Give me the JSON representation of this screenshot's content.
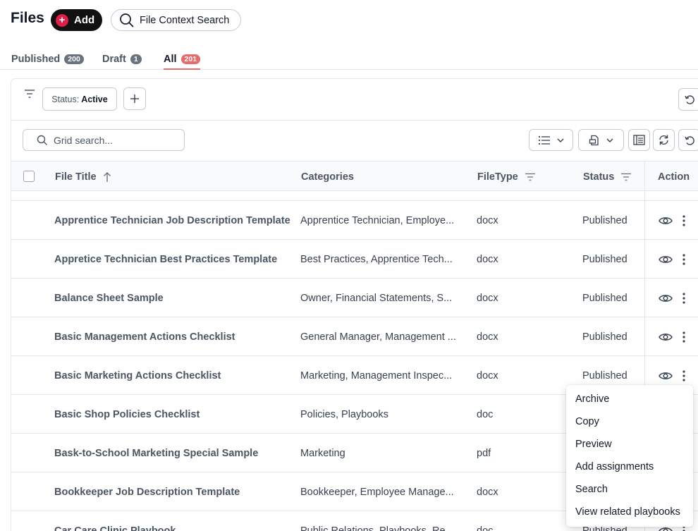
{
  "header": {
    "title": "Files",
    "add_label": "Add",
    "context_search_label": "File Context Search"
  },
  "tabs": [
    {
      "label": "Published",
      "count": "200"
    },
    {
      "label": "Draft",
      "count": "1"
    },
    {
      "label": "All",
      "count": "201",
      "active": true
    }
  ],
  "filters": {
    "status_key": "Status:",
    "status_value": "Active"
  },
  "toolbar": {
    "search_placeholder": "Grid search..."
  },
  "table": {
    "columns": [
      "File Title",
      "Categories",
      "FileType",
      "Status",
      "Action"
    ],
    "sort": {
      "column": "File Title",
      "direction": "ascending"
    },
    "rows": [
      {
        "title": "Apprentice Technician Job Description Template",
        "categories": "Apprentice Technician, Employe...",
        "filetype": "docx",
        "status": "Published"
      },
      {
        "title": "Appretice Technician Best Practices Template",
        "categories": "Best Practices, Apprentice Tech...",
        "filetype": "docx",
        "status": "Published"
      },
      {
        "title": "Balance Sheet Sample",
        "categories": "Owner, Financial Statements, S...",
        "filetype": "docx",
        "status": "Published"
      },
      {
        "title": "Basic Management Actions Checklist",
        "categories": "General Manager, Management ...",
        "filetype": "docx",
        "status": "Published"
      },
      {
        "title": "Basic Marketing Actions Checklist",
        "categories": "Marketing, Management Inspec...",
        "filetype": "docx",
        "status": "Published"
      },
      {
        "title": "Basic Shop Policies Checklist",
        "categories": "Policies, Playbooks",
        "filetype": "doc",
        "status": ""
      },
      {
        "title": "Bask-to-School Marketing Special Sample",
        "categories": "Marketing",
        "filetype": "pdf",
        "status": ""
      },
      {
        "title": "Bookkeeper Job Description Template",
        "categories": "Bookkeeper, Employee Manage...",
        "filetype": "docx",
        "status": ""
      },
      {
        "title": "Car Care Clinic Playbook",
        "categories": "Public Relations, Playbooks, Re...",
        "filetype": "doc",
        "status": "Published"
      }
    ]
  },
  "context_menu": {
    "items": [
      "Archive",
      "Copy",
      "Preview",
      "Add assignments",
      "Search",
      "View related playbooks"
    ]
  },
  "colors": {
    "accent": "#e86a6a",
    "add_button_bg": "#111111",
    "add_plus": "#e11d48"
  }
}
